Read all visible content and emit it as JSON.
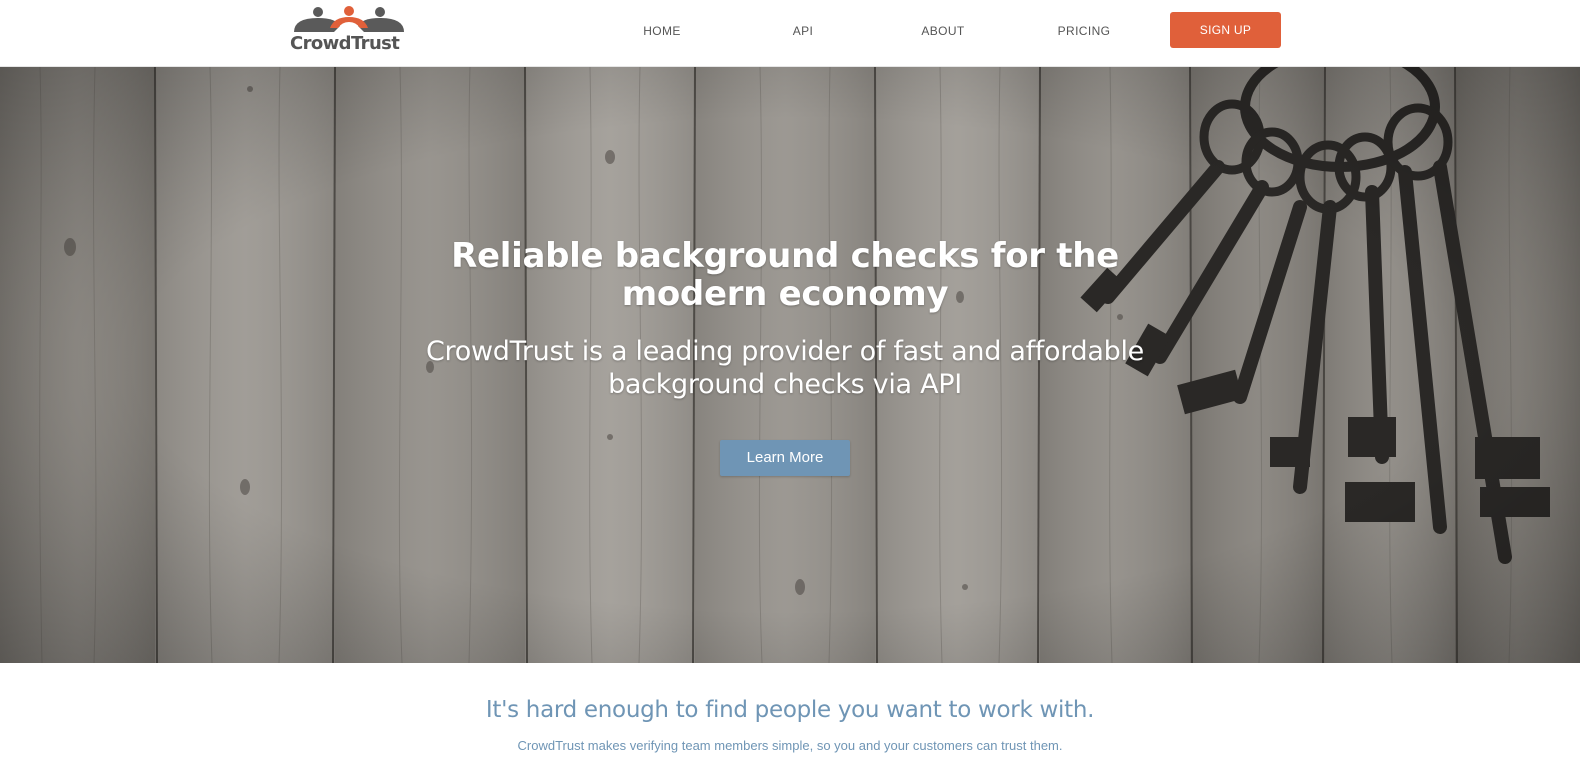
{
  "nav": {
    "logo_text": "CrowdTrust",
    "items": [
      {
        "id": "home",
        "label": "HOME"
      },
      {
        "id": "api",
        "label": "API"
      },
      {
        "id": "about",
        "label": "ABOUT"
      },
      {
        "id": "pricing",
        "label": "PRICING"
      }
    ],
    "signup_label": "SIGN UP"
  },
  "hero": {
    "title": "Reliable background checks for the modern economy",
    "subtitle": "CrowdTrust is a leading provider of fast and affordable background checks via API",
    "cta_label": "Learn More"
  },
  "intro": {
    "heading": "It's hard enough to find people you want to work with.",
    "subheading": "CrowdTrust makes verifying team members simple, so you and your customers can trust them."
  },
  "colors": {
    "accent": "#e0603a",
    "secondary": "#6f95b5",
    "nav_text": "#555555"
  },
  "icons": {
    "logo": "three-people-icon",
    "hero_image": "keys-on-wood"
  }
}
